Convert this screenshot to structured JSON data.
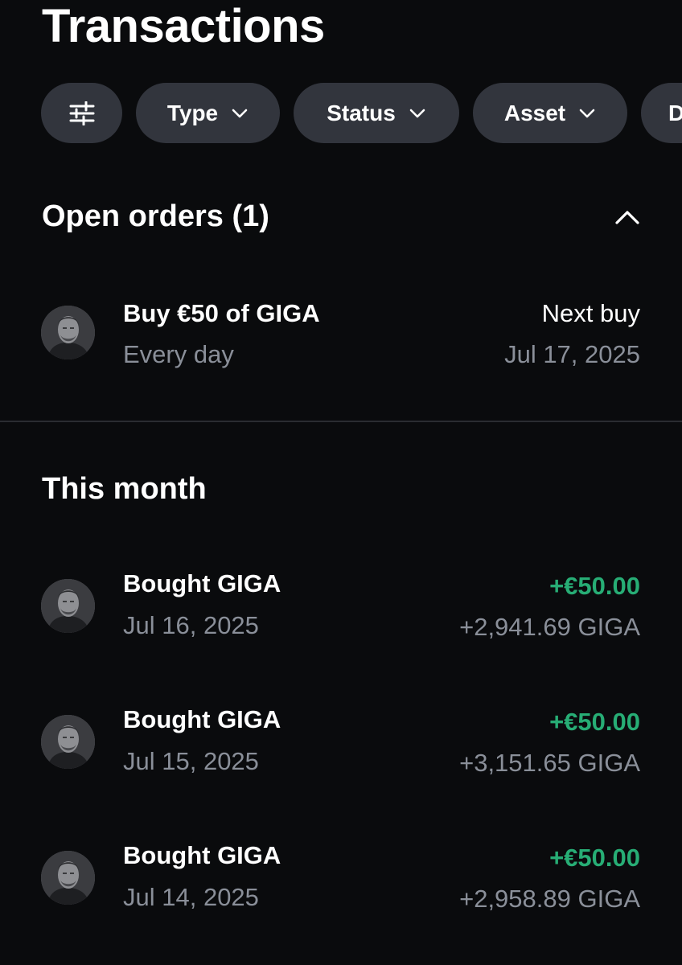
{
  "page": {
    "title": "Transactions"
  },
  "filters": {
    "settings_icon": "sliders-icon",
    "chips": [
      {
        "label": "Type"
      },
      {
        "label": "Status"
      },
      {
        "label": "Asset"
      },
      {
        "label": "D"
      }
    ]
  },
  "open_orders": {
    "heading": "Open orders (1)",
    "toggle_icon": "chevron-up-icon",
    "items": [
      {
        "title": "Buy €50 of GIGA",
        "subtitle": "Every day",
        "right_label": "Next buy",
        "right_value": "Jul 17, 2025",
        "avatar_icon": "giga-chad-avatar-icon"
      }
    ]
  },
  "this_month": {
    "heading": "This month",
    "items": [
      {
        "title": "Bought GIGA",
        "date": "Jul 16, 2025",
        "amount": "+€50.00",
        "quantity": "+2,941.69 GIGA",
        "avatar_icon": "giga-chad-avatar-icon"
      },
      {
        "title": "Bought GIGA",
        "date": "Jul 15, 2025",
        "amount": "+€50.00",
        "quantity": "+3,151.65 GIGA",
        "avatar_icon": "giga-chad-avatar-icon"
      },
      {
        "title": "Bought GIGA",
        "date": "Jul 14, 2025",
        "amount": "+€50.00",
        "quantity": "+2,958.89 GIGA",
        "avatar_icon": "giga-chad-avatar-icon"
      }
    ]
  },
  "colors": {
    "background": "#0a0b0d",
    "chip": "#32353d",
    "text_primary": "#ffffff",
    "text_secondary": "#8a8f99",
    "positive": "#27ad75",
    "divider": "#2a2c31"
  }
}
